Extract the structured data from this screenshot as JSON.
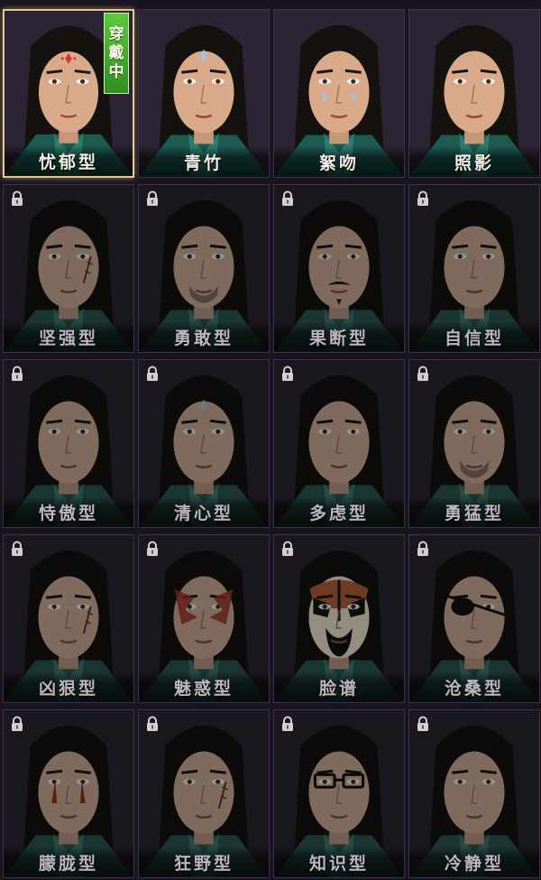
{
  "wearing_badge": [
    "穿",
    "戴",
    "中"
  ],
  "cards": [
    {
      "label": "忧郁型",
      "locked": false,
      "selected": true,
      "mark": "forehead-red"
    },
    {
      "label": "青竹",
      "locked": false,
      "selected": false,
      "mark": "forehead-blue"
    },
    {
      "label": "絮吻",
      "locked": false,
      "selected": false,
      "mark": "cheek-blue"
    },
    {
      "label": "照影",
      "locked": false,
      "selected": false,
      "mark": "none"
    },
    {
      "label": "坚强型",
      "locked": true,
      "selected": false,
      "mark": "scar"
    },
    {
      "label": "勇敢型",
      "locked": true,
      "selected": false,
      "mark": "stubble"
    },
    {
      "label": "果断型",
      "locked": true,
      "selected": false,
      "mark": "mustache"
    },
    {
      "label": "自信型",
      "locked": true,
      "selected": false,
      "mark": "none"
    },
    {
      "label": "恃傲型",
      "locked": true,
      "selected": false,
      "mark": "none"
    },
    {
      "label": "清心型",
      "locked": true,
      "selected": false,
      "mark": "forehead-blue"
    },
    {
      "label": "多虑型",
      "locked": true,
      "selected": false,
      "mark": "none"
    },
    {
      "label": "勇猛型",
      "locked": true,
      "selected": false,
      "mark": "stubble"
    },
    {
      "label": "凶狠型",
      "locked": true,
      "selected": false,
      "mark": "scar"
    },
    {
      "label": "魅惑型",
      "locked": true,
      "selected": false,
      "mark": "red-paint"
    },
    {
      "label": "脸谱",
      "locked": true,
      "selected": false,
      "mark": "opera-mask"
    },
    {
      "label": "沧桑型",
      "locked": true,
      "selected": false,
      "mark": "eyepatch"
    },
    {
      "label": "朦胧型",
      "locked": true,
      "selected": false,
      "mark": "red-tears"
    },
    {
      "label": "狂野型",
      "locked": true,
      "selected": false,
      "mark": "scar"
    },
    {
      "label": "知识型",
      "locked": true,
      "selected": false,
      "mark": "glasses"
    },
    {
      "label": "冷静型",
      "locked": true,
      "selected": false,
      "mark": "none"
    }
  ]
}
